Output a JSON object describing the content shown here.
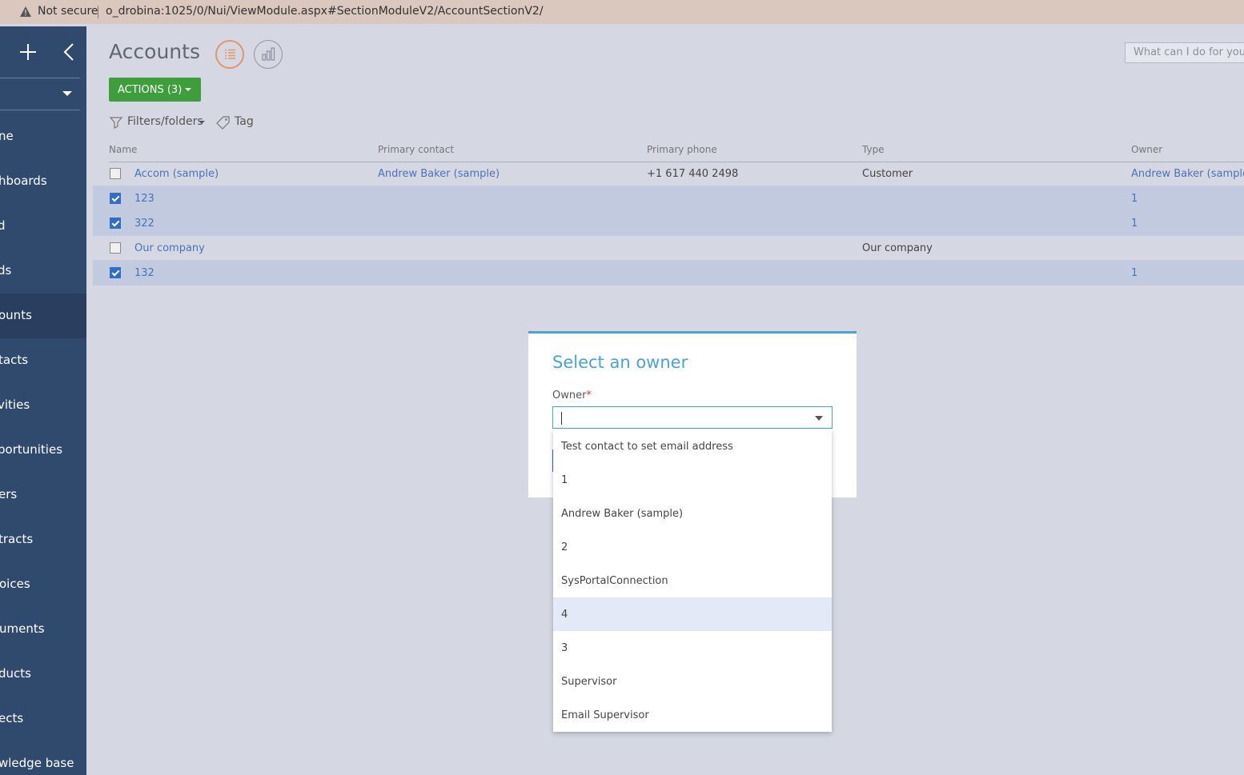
{
  "browser": {
    "security_label": "Not secure",
    "url": "o_drobina:1025/0/Nui/ViewModule.aspx#SectionModuleV2/AccountSectionV2/"
  },
  "sidebar": {
    "items": [
      {
        "label": "ne"
      },
      {
        "label": "hboards"
      },
      {
        "label": "d"
      },
      {
        "label": "ds"
      },
      {
        "label": "ounts"
      },
      {
        "label": "tacts"
      },
      {
        "label": "vities"
      },
      {
        "label": "portunities"
      },
      {
        "label": "ers"
      },
      {
        "label": "tracts"
      },
      {
        "label": "oices"
      },
      {
        "label": "uments"
      },
      {
        "label": "ducts"
      },
      {
        "label": "ects"
      },
      {
        "label": "wledge base"
      }
    ],
    "active_index": 4
  },
  "header": {
    "title": "Accounts",
    "search_placeholder": "What can I do for you?",
    "actions_label": "ACTIONS (3)",
    "filters_label": "Filters/folders",
    "tag_label": "Tag"
  },
  "grid": {
    "columns": [
      "Name",
      "Primary contact",
      "Primary phone",
      "Type",
      "Owner"
    ],
    "rows": [
      {
        "name": "Accom (sample)",
        "contact": "Andrew Baker (sample)",
        "phone": "+1 617 440 2498",
        "type": "Customer",
        "owner": "Andrew Baker (sample)",
        "selected": false
      },
      {
        "name": "123",
        "contact": "",
        "phone": "",
        "type": "",
        "owner": "1",
        "selected": true
      },
      {
        "name": "322",
        "contact": "",
        "phone": "",
        "type": "",
        "owner": "1",
        "selected": true
      },
      {
        "name": "Our company",
        "contact": "",
        "phone": "",
        "type": "Our company",
        "owner": "",
        "selected": false
      },
      {
        "name": "132",
        "contact": "",
        "phone": "",
        "type": "",
        "owner": "1",
        "selected": true
      }
    ]
  },
  "modal": {
    "title": "Select an owner",
    "field_label": "Owner",
    "required_mark": "*",
    "input_value": "",
    "options": [
      "Test contact to set email address",
      "1",
      "Andrew Baker (sample)",
      "2",
      "SysPortalConnection",
      "4",
      "3",
      "Supervisor",
      "Email Supervisor"
    ],
    "highlighted_index": 5
  },
  "colors": {
    "sidebar": "#304a6e",
    "accent_green": "#3e9e3c",
    "accent_blue": "#4aa3d6",
    "link": "#4a72b8",
    "selected_row": "#c2cadf"
  }
}
